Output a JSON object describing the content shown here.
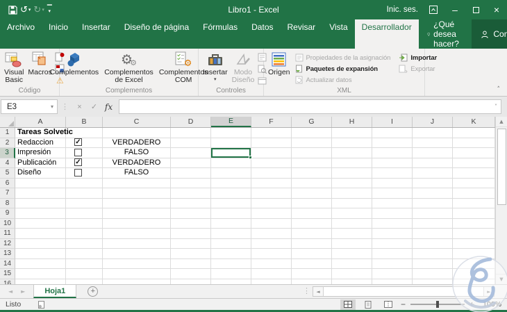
{
  "titlebar": {
    "title": "Libro1 - Excel",
    "signin": "Inic. ses."
  },
  "icons": {
    "undo": "↺",
    "redo": "↻",
    "caret_down": "▾",
    "grip": "⋮",
    "cancel": "×",
    "check": "✓",
    "chevron_down": "˅",
    "collapse_ribbon": "˄",
    "scroll_up": "▲",
    "scroll_down": "▼",
    "scroll_left": "◄",
    "scroll_right": "►",
    "sheet_prev": "◄",
    "sheet_next": "►",
    "new_sheet": "+",
    "minus": "−",
    "plus": "+",
    "minimize": "–",
    "close": "×",
    "warning": "⚠",
    "gear": "⚙"
  },
  "ribbon": {
    "tabs": [
      {
        "label": "Archivo"
      },
      {
        "label": "Inicio"
      },
      {
        "label": "Insertar"
      },
      {
        "label": "Diseño de página"
      },
      {
        "label": "Fórmulas"
      },
      {
        "label": "Datos"
      },
      {
        "label": "Revisar"
      },
      {
        "label": "Vista"
      },
      {
        "label": "Desarrollador",
        "active": true
      }
    ],
    "help_tab": "¿Qué desea hacer?",
    "share_button": "Compartir",
    "groups": {
      "codigo": {
        "label": "Código",
        "visual_basic": "Visual Basic",
        "macros": "Macros"
      },
      "complementos": {
        "label": "Complementos",
        "complementos": "Complementos",
        "complementos_excel": "Complementos de Excel",
        "complementos_com": "Complementos COM"
      },
      "controles": {
        "label": "Controles",
        "insertar": "Insertar",
        "modo_diseno": "Modo Diseño"
      },
      "xml": {
        "label": "XML",
        "origen": "Origen",
        "propiedades": "Propiedades de la asignación",
        "paquetes": "Paquetes de expansión",
        "actualizar": "Actualizar datos",
        "importar": "Importar",
        "exportar": "Exportar"
      }
    }
  },
  "formula_bar": {
    "name_box": "E3",
    "fx": "fx",
    "formula_value": ""
  },
  "sheet": {
    "selected_cell": "E3",
    "selected_column": "E",
    "selected_row": 3,
    "row_count": 17,
    "row_height": 14.5,
    "columns": [
      {
        "letter": "A",
        "width": 73
      },
      {
        "letter": "B",
        "width": 53
      },
      {
        "letter": "C",
        "width": 98
      },
      {
        "letter": "D",
        "width": 58
      },
      {
        "letter": "E",
        "width": 58
      },
      {
        "letter": "F",
        "width": 58
      },
      {
        "letter": "G",
        "width": 58
      },
      {
        "letter": "H",
        "width": 58
      },
      {
        "letter": "I",
        "width": 58
      },
      {
        "letter": "J",
        "width": 58
      },
      {
        "letter": "K",
        "width": 61
      }
    ],
    "rows": [
      {
        "n": 1,
        "cells": {
          "A": {
            "text": "Tareas Solvetic",
            "bold": true
          }
        }
      },
      {
        "n": 2,
        "cells": {
          "A": {
            "text": "Redaccion"
          },
          "B": {
            "checkbox": true,
            "checked": true
          },
          "C": {
            "text": "VERDADERO"
          }
        }
      },
      {
        "n": 3,
        "cells": {
          "A": {
            "text": "Impresión"
          },
          "B": {
            "checkbox": true,
            "checked": false
          },
          "C": {
            "text": "FALSO"
          }
        }
      },
      {
        "n": 4,
        "cells": {
          "A": {
            "text": "Publicación"
          },
          "B": {
            "checkbox": true,
            "checked": true
          },
          "C": {
            "text": "VERDADERO"
          }
        }
      },
      {
        "n": 5,
        "cells": {
          "A": {
            "text": "Diseño"
          },
          "B": {
            "checkbox": true,
            "checked": false
          },
          "C": {
            "text": "FALSO"
          }
        }
      }
    ]
  },
  "sheet_tabs": {
    "active": "Hoja1"
  },
  "status_bar": {
    "mode": "Listo",
    "zoom": "100%"
  },
  "colors": {
    "excel_green": "#217346",
    "share_green": "#1a5c38",
    "selection_border": "#217346"
  }
}
